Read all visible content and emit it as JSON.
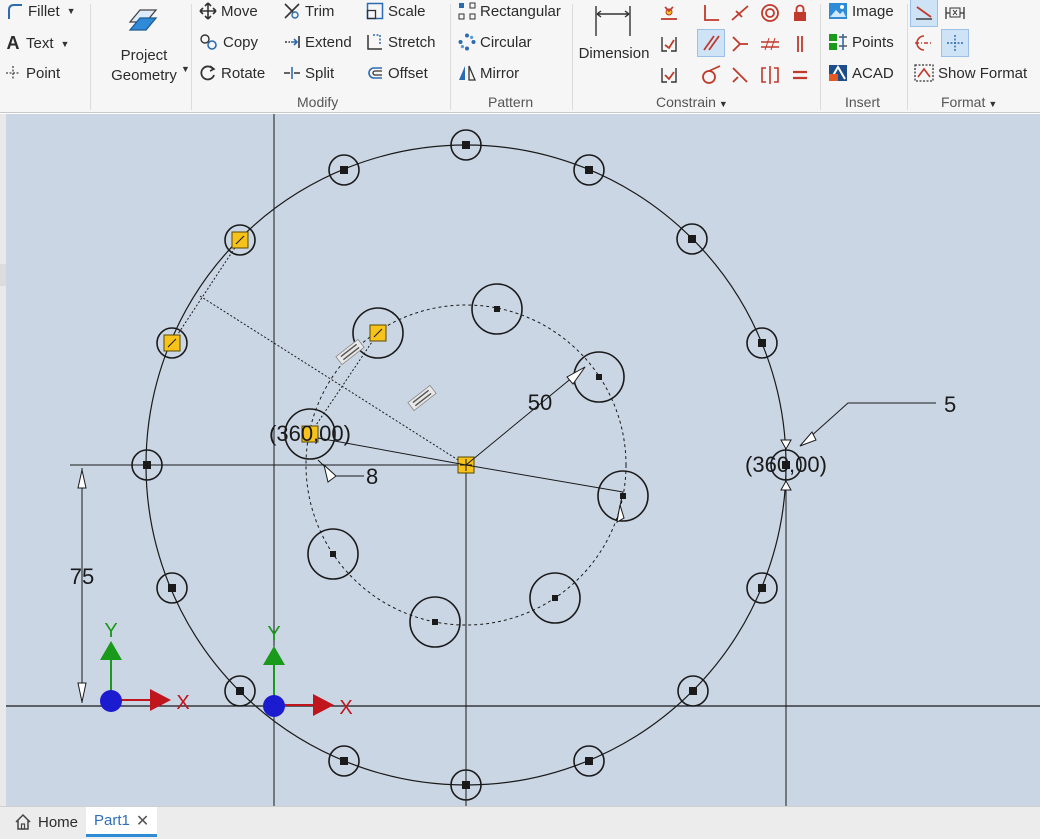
{
  "ribbon": {
    "draw": {
      "fillet": "Fillet",
      "text": "Text",
      "point": "Point"
    },
    "project_geometry": {
      "line1": "Project",
      "line2": "Geometry"
    },
    "modify": {
      "label": "Modify",
      "move": "Move",
      "copy": "Copy",
      "rotate": "Rotate",
      "trim": "Trim",
      "extend": "Extend",
      "split": "Split",
      "scale": "Scale",
      "stretch": "Stretch",
      "offset": "Offset"
    },
    "pattern": {
      "label": "Pattern",
      "rectangular": "Rectangular",
      "circular": "Circular",
      "mirror": "Mirror"
    },
    "constrain": {
      "label": "Constrain",
      "dimension": "Dimension"
    },
    "insert": {
      "label": "Insert",
      "image": "Image",
      "points": "Points",
      "acad": "ACAD"
    },
    "format": {
      "label": "Format",
      "show_format": "Show Format"
    }
  },
  "sketch": {
    "dims": {
      "radius_inner": "50",
      "diameter_outer_hole": "5",
      "diameter_inner_hole": "8",
      "vertical_offset": "75",
      "pattern_count_left": "(360,00)",
      "pattern_count_right": "(360,00)"
    },
    "axis_labels": {
      "x": "X",
      "y": "Y"
    }
  },
  "tabs": {
    "home": "Home",
    "part": "Part1"
  },
  "colors": {
    "canvas_bg": "#cbd6e5",
    "selected_fill": "#f7c31b",
    "axis_x": "#c0151c",
    "axis_y": "#1a9a1a",
    "origin": "#1b1bd0",
    "tab_accent": "#2e8bd6"
  }
}
